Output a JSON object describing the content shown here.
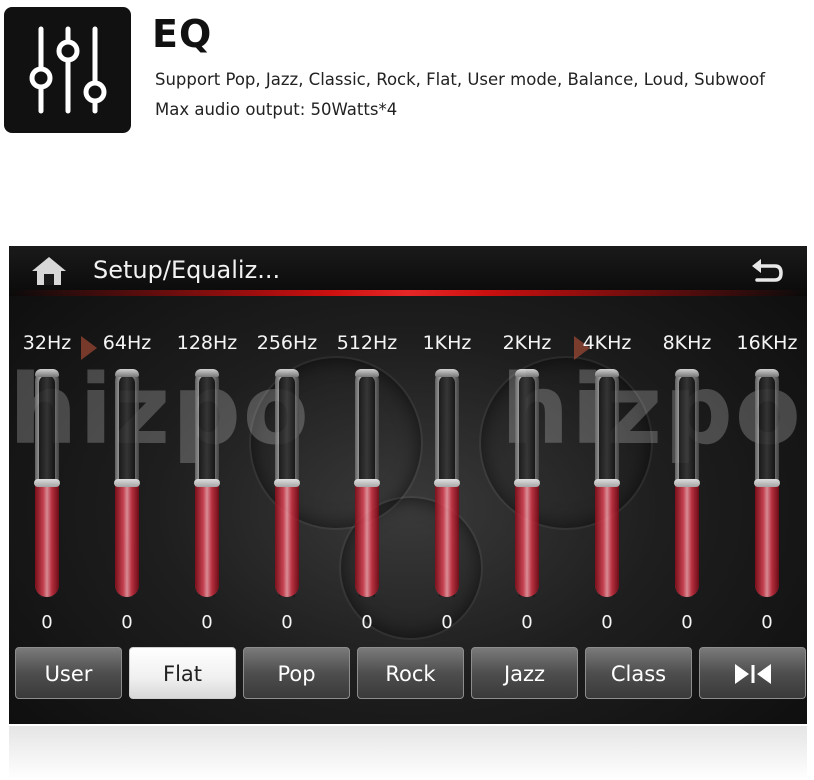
{
  "promo": {
    "title": "EQ",
    "line1": "Support Pop, Jazz, Classic, Rock, Flat, User mode, Balance, Loud, Subwoof",
    "line2": "Max audio output: 50Watts*4",
    "logo_icon": "equalizer-sliders-icon"
  },
  "screen": {
    "title": "Setup/Equaliz...",
    "home_icon": "home-icon",
    "back_icon": "back-arrow-icon",
    "watermark": "hizpo"
  },
  "bands": [
    {
      "label": "32Hz",
      "value": "0",
      "level": 0.5
    },
    {
      "label": "64Hz",
      "value": "0",
      "level": 0.5
    },
    {
      "label": "128Hz",
      "value": "0",
      "level": 0.5
    },
    {
      "label": "256Hz",
      "value": "0",
      "level": 0.5
    },
    {
      "label": "512Hz",
      "value": "0",
      "level": 0.5
    },
    {
      "label": "1KHz",
      "value": "0",
      "level": 0.5
    },
    {
      "label": "2KHz",
      "value": "0",
      "level": 0.5
    },
    {
      "label": "4KHz",
      "value": "0",
      "level": 0.5
    },
    {
      "label": "8KHz",
      "value": "0",
      "level": 0.5
    },
    {
      "label": "16KHz",
      "value": "0",
      "level": 0.5
    }
  ],
  "presets": [
    {
      "label": "User",
      "active": false
    },
    {
      "label": "Flat",
      "active": true
    },
    {
      "label": "Pop",
      "active": false
    },
    {
      "label": "Rock",
      "active": false
    },
    {
      "label": "Jazz",
      "active": false
    },
    {
      "label": "Class",
      "active": false
    }
  ],
  "balance_button_icon": "balance-icon",
  "colors": {
    "fill": "#e2485a",
    "accent_glow": "#ff2a2a",
    "button": "#4e4e4e",
    "button_active": "#f0f0f0"
  }
}
